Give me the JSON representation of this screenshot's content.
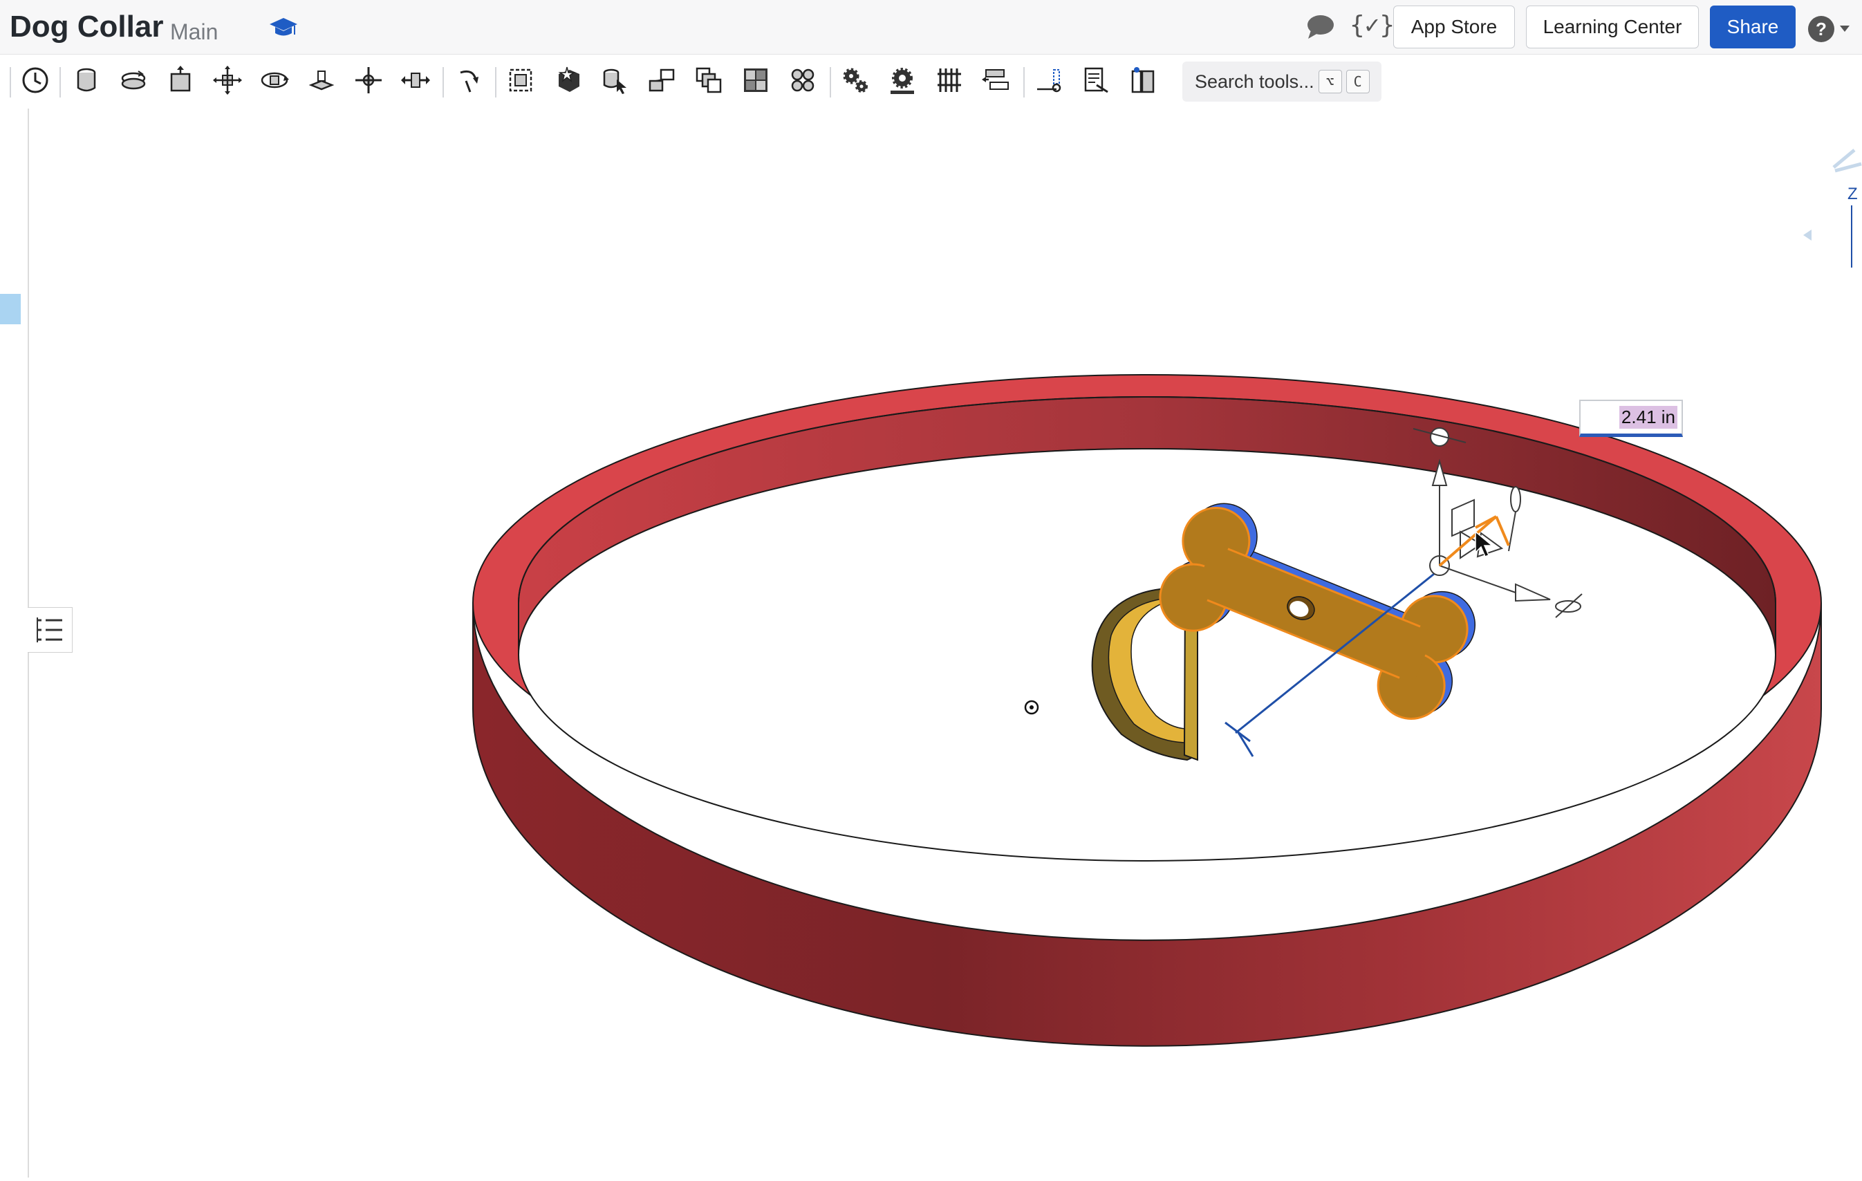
{
  "document": {
    "title": "Dog Collar",
    "branch": "Main"
  },
  "header_buttons": {
    "app_store": "App Store",
    "learning_center": "Learning Center",
    "share": "Share"
  },
  "header_icons": [
    "learning-cap-icon",
    "comment-icon",
    "variable-icon",
    "help-icon"
  ],
  "toolbar": {
    "tools": [
      "history-icon",
      "cylinder-icon",
      "revolute-icon",
      "extrude-icon",
      "move-icon",
      "rotate-move-icon",
      "planar-icon",
      "fastened-icon",
      "slider-icon",
      "mate-connector-icon",
      "group-icon",
      "insert-part-icon",
      "insert-assembly-icon",
      "replicate-icon",
      "pattern-icon",
      "grid-pattern-icon",
      "circular-pattern-icon",
      "gear-icon",
      "gear-relation-icon",
      "rack-pinion-icon",
      "screw-relation-icon",
      "measure-icon",
      "notes-icon",
      "bom-icon"
    ],
    "search_placeholder": "Search tools...",
    "search_shortcut": [
      "⌥",
      "C"
    ]
  },
  "viewport": {
    "dimension_value": "2.41 in",
    "axis_label": "Z",
    "colors": {
      "collar": "#d9454b",
      "bone": "#b27a1c",
      "bone_side": "#3f6be0",
      "ring": "#7a6325",
      "manipulator": "#f08a1c",
      "dimension_line": "#1f4fa8"
    }
  }
}
